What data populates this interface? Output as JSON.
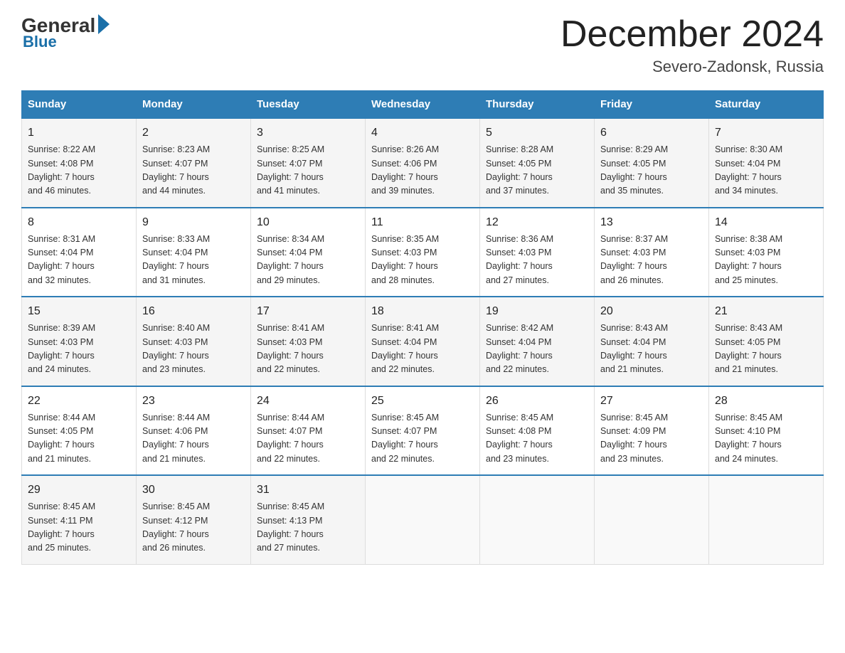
{
  "header": {
    "logo_general": "General",
    "logo_blue": "Blue",
    "month_title": "December 2024",
    "location": "Severo-Zadonsk, Russia"
  },
  "columns": [
    "Sunday",
    "Monday",
    "Tuesday",
    "Wednesday",
    "Thursday",
    "Friday",
    "Saturday"
  ],
  "weeks": [
    [
      {
        "day": "1",
        "sunrise": "8:22 AM",
        "sunset": "4:08 PM",
        "daylight": "7 hours and 46 minutes."
      },
      {
        "day": "2",
        "sunrise": "8:23 AM",
        "sunset": "4:07 PM",
        "daylight": "7 hours and 44 minutes."
      },
      {
        "day": "3",
        "sunrise": "8:25 AM",
        "sunset": "4:07 PM",
        "daylight": "7 hours and 41 minutes."
      },
      {
        "day": "4",
        "sunrise": "8:26 AM",
        "sunset": "4:06 PM",
        "daylight": "7 hours and 39 minutes."
      },
      {
        "day": "5",
        "sunrise": "8:28 AM",
        "sunset": "4:05 PM",
        "daylight": "7 hours and 37 minutes."
      },
      {
        "day": "6",
        "sunrise": "8:29 AM",
        "sunset": "4:05 PM",
        "daylight": "7 hours and 35 minutes."
      },
      {
        "day": "7",
        "sunrise": "8:30 AM",
        "sunset": "4:04 PM",
        "daylight": "7 hours and 34 minutes."
      }
    ],
    [
      {
        "day": "8",
        "sunrise": "8:31 AM",
        "sunset": "4:04 PM",
        "daylight": "7 hours and 32 minutes."
      },
      {
        "day": "9",
        "sunrise": "8:33 AM",
        "sunset": "4:04 PM",
        "daylight": "7 hours and 31 minutes."
      },
      {
        "day": "10",
        "sunrise": "8:34 AM",
        "sunset": "4:04 PM",
        "daylight": "7 hours and 29 minutes."
      },
      {
        "day": "11",
        "sunrise": "8:35 AM",
        "sunset": "4:03 PM",
        "daylight": "7 hours and 28 minutes."
      },
      {
        "day": "12",
        "sunrise": "8:36 AM",
        "sunset": "4:03 PM",
        "daylight": "7 hours and 27 minutes."
      },
      {
        "day": "13",
        "sunrise": "8:37 AM",
        "sunset": "4:03 PM",
        "daylight": "7 hours and 26 minutes."
      },
      {
        "day": "14",
        "sunrise": "8:38 AM",
        "sunset": "4:03 PM",
        "daylight": "7 hours and 25 minutes."
      }
    ],
    [
      {
        "day": "15",
        "sunrise": "8:39 AM",
        "sunset": "4:03 PM",
        "daylight": "7 hours and 24 minutes."
      },
      {
        "day": "16",
        "sunrise": "8:40 AM",
        "sunset": "4:03 PM",
        "daylight": "7 hours and 23 minutes."
      },
      {
        "day": "17",
        "sunrise": "8:41 AM",
        "sunset": "4:03 PM",
        "daylight": "7 hours and 22 minutes."
      },
      {
        "day": "18",
        "sunrise": "8:41 AM",
        "sunset": "4:04 PM",
        "daylight": "7 hours and 22 minutes."
      },
      {
        "day": "19",
        "sunrise": "8:42 AM",
        "sunset": "4:04 PM",
        "daylight": "7 hours and 22 minutes."
      },
      {
        "day": "20",
        "sunrise": "8:43 AM",
        "sunset": "4:04 PM",
        "daylight": "7 hours and 21 minutes."
      },
      {
        "day": "21",
        "sunrise": "8:43 AM",
        "sunset": "4:05 PM",
        "daylight": "7 hours and 21 minutes."
      }
    ],
    [
      {
        "day": "22",
        "sunrise": "8:44 AM",
        "sunset": "4:05 PM",
        "daylight": "7 hours and 21 minutes."
      },
      {
        "day": "23",
        "sunrise": "8:44 AM",
        "sunset": "4:06 PM",
        "daylight": "7 hours and 21 minutes."
      },
      {
        "day": "24",
        "sunrise": "8:44 AM",
        "sunset": "4:07 PM",
        "daylight": "7 hours and 22 minutes."
      },
      {
        "day": "25",
        "sunrise": "8:45 AM",
        "sunset": "4:07 PM",
        "daylight": "7 hours and 22 minutes."
      },
      {
        "day": "26",
        "sunrise": "8:45 AM",
        "sunset": "4:08 PM",
        "daylight": "7 hours and 23 minutes."
      },
      {
        "day": "27",
        "sunrise": "8:45 AM",
        "sunset": "4:09 PM",
        "daylight": "7 hours and 23 minutes."
      },
      {
        "day": "28",
        "sunrise": "8:45 AM",
        "sunset": "4:10 PM",
        "daylight": "7 hours and 24 minutes."
      }
    ],
    [
      {
        "day": "29",
        "sunrise": "8:45 AM",
        "sunset": "4:11 PM",
        "daylight": "7 hours and 25 minutes."
      },
      {
        "day": "30",
        "sunrise": "8:45 AM",
        "sunset": "4:12 PM",
        "daylight": "7 hours and 26 minutes."
      },
      {
        "day": "31",
        "sunrise": "8:45 AM",
        "sunset": "4:13 PM",
        "daylight": "7 hours and 27 minutes."
      },
      null,
      null,
      null,
      null
    ]
  ],
  "labels": {
    "sunrise": "Sunrise:",
    "sunset": "Sunset:",
    "daylight": "Daylight:"
  }
}
